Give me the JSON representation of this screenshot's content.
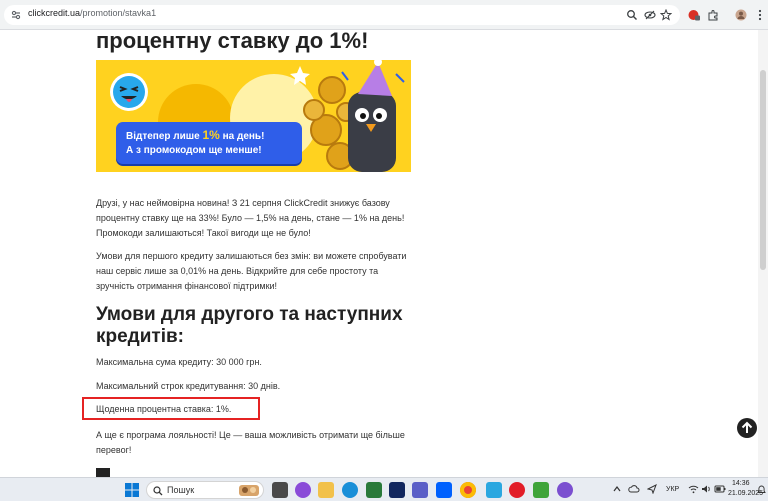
{
  "browser": {
    "url_host": "clickcredit.ua",
    "url_path": "/promotion/stavka1"
  },
  "article": {
    "heading_top": "процентну ставку до 1%!",
    "banner": {
      "line1_pre": "Відтепер лише ",
      "line1_highlight": "1%",
      "line1_post": " на день!",
      "line2": "А з промокодом ще менше!"
    },
    "para1": [
      "Друзі, у нас неймовірна новина! З 21 серпня ClickCredit знижує базову",
      "процентну ставку ще на 33%! Було — 1,5% на день, стане — 1% на день!",
      "Промокоди залишаються! Такої вигоди ще не було!"
    ],
    "para2": [
      "Умови для першого кредиту залишаються без змін: ви можете спробувати",
      "наш сервіс лише за 0,01% на день. Відкрийте для себе простоту та",
      "зручність отримання фінансової підтримки!"
    ],
    "heading2": [
      "Умови для другого та наступних",
      "кредитів:"
    ],
    "conditions": [
      "Максимальна сума кредиту: 30 000 грн.",
      "Максимальний строк кредитування: 30 днів.",
      "Щоденна процентна ставка: 1%."
    ],
    "para3": [
      "А ще є програма лояльності! Це — ваша можливість отримати ще більше",
      "перевог!"
    ]
  },
  "taskbar": {
    "search_placeholder": "Пошук",
    "lang": "УКР",
    "time": "14:36",
    "date": "21.09.2025"
  }
}
